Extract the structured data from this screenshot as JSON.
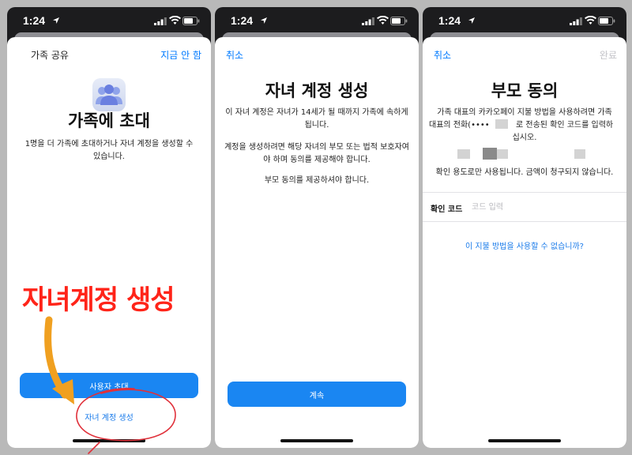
{
  "status_bar": {
    "time": "1:24"
  },
  "screens": [
    {
      "nav": {
        "left": "가족 공유",
        "right": "지금 안 함"
      },
      "title": "가족에 초대",
      "description": "1명을 더 가족에 초대하거나 자녀 계정을 생성할 수 있습니다.",
      "primary_button": "사용자 초대",
      "link_button": "자녀 계정 생성"
    },
    {
      "nav": {
        "left": "취소"
      },
      "title": "자녀 계정 생성",
      "paragraphs": [
        "이 자녀 계정은 자녀가 14세가 될 때까지 가족에 속하게 됩니다.",
        "계정을 생성하려면 해당 자녀의 부모 또는 법적 보호자여야 하며 동의를 제공해야 합니다.",
        "부모 동의를 제공하셔야 합니다."
      ],
      "primary_button": "계속"
    },
    {
      "nav": {
        "left": "취소",
        "right": "완료"
      },
      "title": "부모 동의",
      "description_line1": "가족 대표의 카카오페이 지불 방법을 사용하려면 가족",
      "description_line2a": "대표의 전화(••••",
      "description_line2b": "로 전송된 확인 코드를 입력하",
      "description_line3": "십시오.",
      "note": "확인 용도로만 사용됩니다. 금액이 청구되지 않습니다.",
      "field_label": "확인 코드",
      "field_placeholder": "코드 입력",
      "field_value": "",
      "link_button": "이 지불 방법을 사용할 수 없습니까?"
    }
  ],
  "annotation": {
    "text": "자녀계정 생성",
    "text_color": "#ff2419",
    "arrow_color": "#f0a020",
    "circle_color": "#e0303a"
  },
  "colors": {
    "accent": "#007aff",
    "button": "#1a86f2"
  }
}
